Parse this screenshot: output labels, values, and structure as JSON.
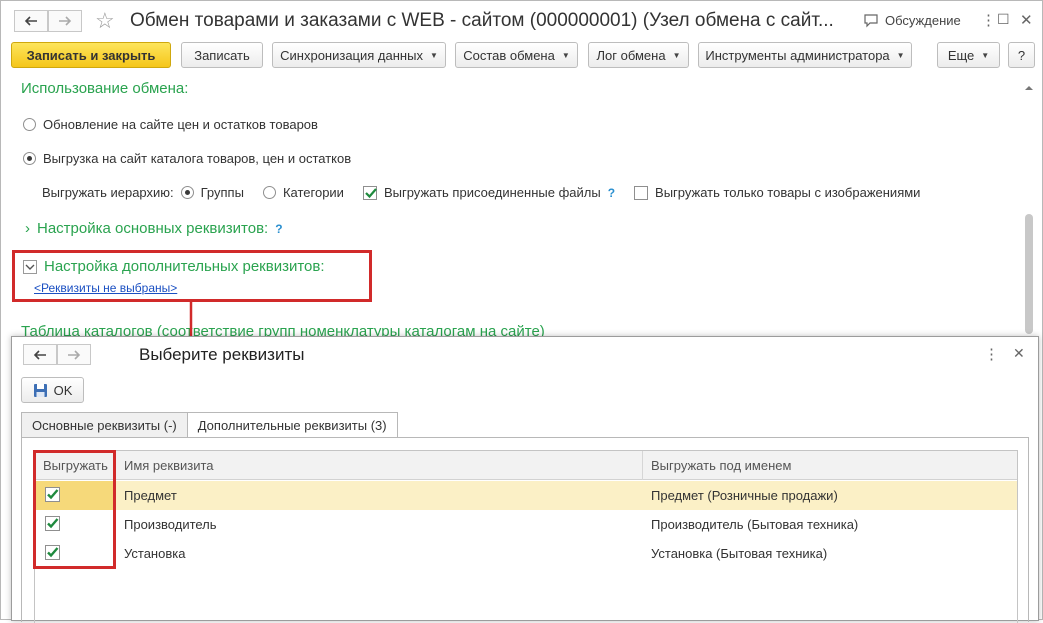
{
  "window": {
    "title": "Обмен товарами и заказами с WEB - сайтом (000000001) (Узел обмена с сайт...",
    "discuss_label": "Обсуждение"
  },
  "toolbar": {
    "save_close": "Записать и закрыть",
    "save": "Записать",
    "sync": "Синхронизация данных",
    "composition": "Состав обмена",
    "log": "Лог обмена",
    "admin_tools": "Инструменты администратора",
    "more": "Еще",
    "help": "?"
  },
  "usage": {
    "heading": "Использование обмена:",
    "option1": "Обновление на сайте цен и остатков товаров",
    "option2": "Выгрузка на сайт каталога товаров, цен и остатков",
    "hierarchy_label": "Выгружать иерархию:",
    "groups": "Группы",
    "categories": "Категории",
    "attached_files": "Выгружать присоединенные файлы",
    "attached_help": "?",
    "only_with_images": "Выгружать только товары с изображениями"
  },
  "basic_attrs": {
    "heading": "Настройка основных реквизитов:",
    "help": "?"
  },
  "extra_attrs": {
    "heading": "Настройка дополнительных реквизитов:",
    "link": "<Реквизиты не выбраны>"
  },
  "catalogs": {
    "heading": "Таблица каталогов (соответствие групп номенклатуры каталогам на сайте)"
  },
  "dialog": {
    "title": "Выберите реквизиты",
    "ok": "OK",
    "tabs": [
      "Основные реквизиты (-)",
      "Дополнительные реквизиты (3)"
    ],
    "columns": [
      "Выгружать",
      "Имя реквизита",
      "Выгружать под именем"
    ],
    "rows": [
      {
        "export": true,
        "name": "Предмет",
        "export_name": "Предмет (Розничные продажи)"
      },
      {
        "export": true,
        "name": "Производитель",
        "export_name": "Производитель (Бытовая техника)"
      },
      {
        "export": true,
        "name": "Установка",
        "export_name": "Установка (Бытовая техника)"
      }
    ]
  },
  "colors": {
    "accent_green": "#2aa34f",
    "highlight_red": "#d12a2a",
    "primary_button": "#f5c61a",
    "selected_row": "#fbf0c6",
    "link_blue": "#1a4fc2"
  }
}
